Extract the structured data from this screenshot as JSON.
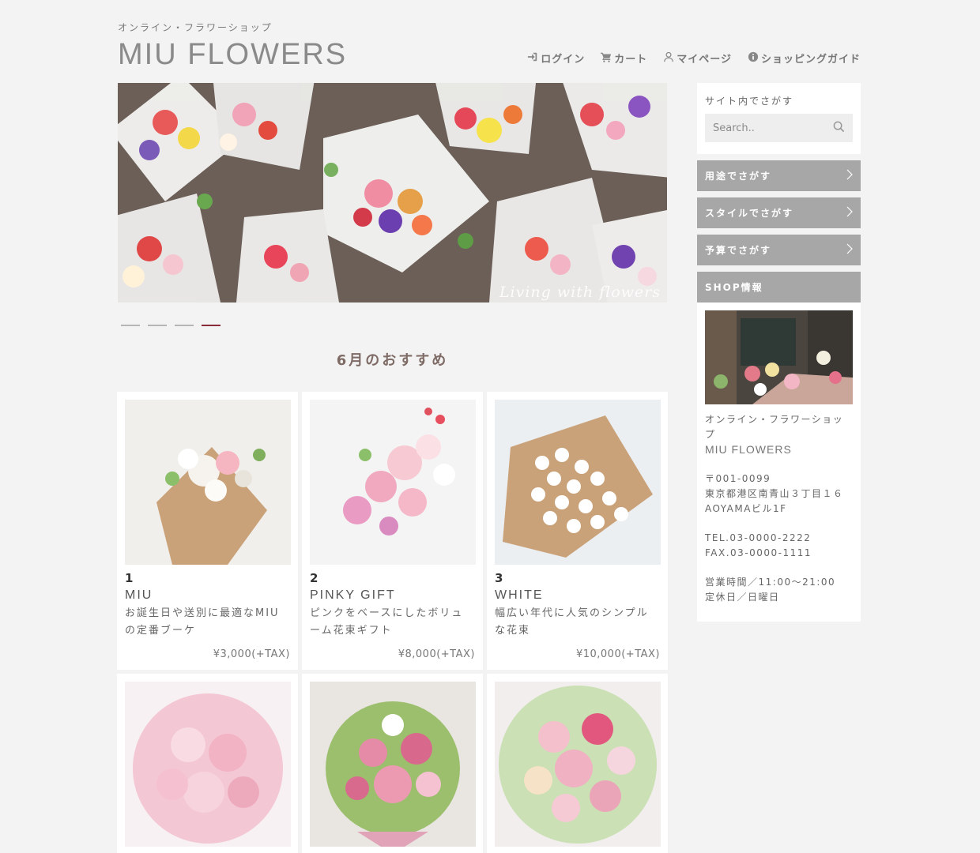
{
  "header": {
    "tagline": "オンライン・フラワーショップ",
    "logo": "MIU FLOWERS",
    "nav": [
      {
        "label": "ログイン",
        "icon": "login-icon"
      },
      {
        "label": "カート",
        "icon": "cart-icon"
      },
      {
        "label": "マイページ",
        "icon": "user-icon"
      },
      {
        "label": "ショッピングガイド",
        "icon": "info-icon"
      }
    ]
  },
  "hero": {
    "caption": "Living with flowers",
    "slides": 4,
    "active_slide": 4
  },
  "section": {
    "title": "6月のおすすめ"
  },
  "products": [
    {
      "rank": "1",
      "name": "MIU",
      "desc": "お誕生日や送別に最適なMIUの定番ブーケ",
      "price": "¥3,000(+TAX)"
    },
    {
      "rank": "2",
      "name": "PINKY GIFT",
      "desc": "ピンクをベースにしたボリューム花束ギフト",
      "price": "¥8,000(+TAX)"
    },
    {
      "rank": "3",
      "name": "WHITE",
      "desc": "幅広い年代に人気のシンプルな花束",
      "price": "¥10,000(+TAX)"
    }
  ],
  "sidebar": {
    "search_label": "サイト内でさがす",
    "search_placeholder": "Search..",
    "menu": [
      "用途でさがす",
      "スタイルでさがす",
      "予算でさがす"
    ],
    "shop_header": "SHOP情報",
    "shop": {
      "tagline": "オンライン・フラワーショップ",
      "name": "MIU FLOWERS",
      "postal": "〒001-0099",
      "address1": "東京都港区南青山３丁目１６",
      "address2": "AOYAMAビル1F",
      "tel": "TEL.03-0000-2222",
      "fax": "FAX.03-0000-1111",
      "hours": "営業時間／11:00〜21:00",
      "closed": "定休日／日曜日"
    }
  },
  "colors": {
    "background": "#f3f3f3",
    "menu_button": "#a7a7a7",
    "active_dot": "#8a2b3a",
    "section_title": "#7f6b66"
  }
}
